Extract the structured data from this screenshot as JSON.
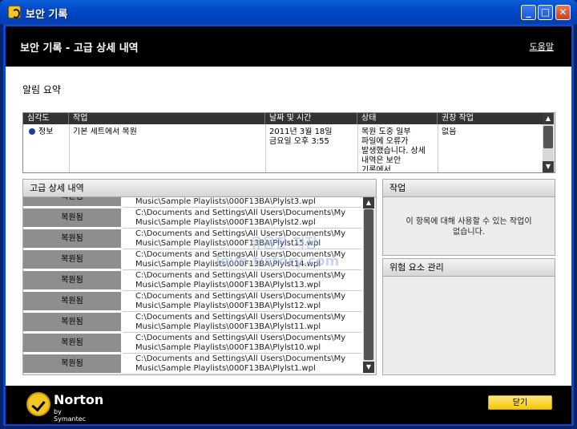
{
  "window": {
    "title": "보안 기록",
    "controls": {
      "minimize": "_",
      "maximize": "□",
      "close": "✕"
    }
  },
  "header": {
    "title": "보안 기록 - 고급 상세 내역",
    "help_link": "도움말"
  },
  "summary": {
    "label": "알림 요약",
    "columns": [
      "심각도",
      "작업",
      "날짜 및 시간",
      "상태",
      "권장 작업"
    ],
    "row": {
      "severity": "정보",
      "task": "기본 세트에서 복원",
      "datetime": "2011년 3월 18일\n금요일 오후 3:55",
      "status": "복원 도중 일부\n파일에 오류가\n발생했습니다. 상세\n내역은 보안\n기록에서 …",
      "recommended": "없음"
    }
  },
  "details": {
    "title": "고급 상세 내역",
    "rows": [
      {
        "status": "복원됨",
        "path": "Music\\Sample Playlists\\000F13BA\\Plylst3.wpl"
      },
      {
        "status": "복원됨",
        "path": "C:\\Documents and Settings\\All Users\\Documents\\My\nMusic\\Sample Playlists\\000F13BA\\Plylst2.wpl"
      },
      {
        "status": "복원됨",
        "path": "C:\\Documents and Settings\\All Users\\Documents\\My\nMusic\\Sample Playlists\\000F13BA\\Plylst15.wpl"
      },
      {
        "status": "복원됨",
        "path": "C:\\Documents and Settings\\All Users\\Documents\\My\nMusic\\Sample Playlists\\000F13BA\\Plylst14.wpl"
      },
      {
        "status": "복원됨",
        "path": "C:\\Documents and Settings\\All Users\\Documents\\My\nMusic\\Sample Playlists\\000F13BA\\Plylst13.wpl"
      },
      {
        "status": "복원됨",
        "path": "C:\\Documents and Settings\\All Users\\Documents\\My\nMusic\\Sample Playlists\\000F13BA\\Plylst12.wpl"
      },
      {
        "status": "복원됨",
        "path": "C:\\Documents and Settings\\All Users\\Documents\\My\nMusic\\Sample Playlists\\000F13BA\\Plylst11.wpl"
      },
      {
        "status": "복원됨",
        "path": "C:\\Documents and Settings\\All Users\\Documents\\My\nMusic\\Sample Playlists\\000F13BA\\Plylst10.wpl"
      },
      {
        "status": "복원됨",
        "path": "C:\\Documents and Settings\\All Users\\Documents\\My\nMusic\\Sample Playlists\\000F13BA\\Plylst1.wpl"
      }
    ]
  },
  "actions_panel": {
    "title": "작업",
    "message": "이 항목에 대해 사용할 수 있는 작업이\n없습니다."
  },
  "risk_panel": {
    "title": "위험 요소 관리"
  },
  "watermark": {
    "line1": "유용한 저장",
    "line2": "love.tistory.com"
  },
  "footer": {
    "brand": "Norton",
    "brand_sub": "by Symantec",
    "close_button": "닫기"
  },
  "colors": {
    "header_bg": "#000000",
    "title_bar": "#0a5fd8",
    "close_button": "#f2c800",
    "status_cell": "#8e8e8e",
    "info_dot": "#1c3e9c"
  }
}
